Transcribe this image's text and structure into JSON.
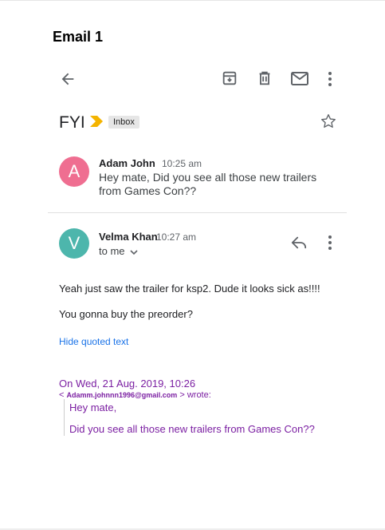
{
  "page": {
    "title": "Email 1"
  },
  "toolbar": {
    "back_icon": "arrow-left-icon",
    "archive_icon": "archive-icon",
    "delete_icon": "trash-icon",
    "mark_unread_icon": "mail-icon",
    "more_icon": "more-vert-icon"
  },
  "thread": {
    "subject": "FYI",
    "label": "Inbox",
    "importance_color": "#f4b400",
    "star_icon": "star-outline-icon"
  },
  "messages": [
    {
      "avatar_letter": "A",
      "avatar_color": "#ef6e91",
      "sender": "Adam John",
      "time": "10:25 am",
      "snippet": "Hey mate, Did you see all those new trailers from Games Con??"
    },
    {
      "avatar_letter": "V",
      "avatar_color": "#4db6ac",
      "sender": "Velma Khan",
      "time": "10:27 am",
      "recipient": "to me",
      "reply_icon": "reply-icon",
      "more_icon": "more-vert-icon",
      "body": [
        "Yeah just saw the trailer for ksp2. Dude it looks sick as!!!!",
        "You gonna buy the preorder?"
      ],
      "hide_quoted": "Hide quoted text",
      "quoted": {
        "date": "On Wed, 21 Aug. 2019, 10:26",
        "addr_open": "< ",
        "email": "Adamm.johnnn1996@gmail.com",
        "addr_close": " > wrote:",
        "lines": [
          "Hey mate,",
          "Did you see all those new trailers from Games Con??"
        ]
      }
    }
  ]
}
